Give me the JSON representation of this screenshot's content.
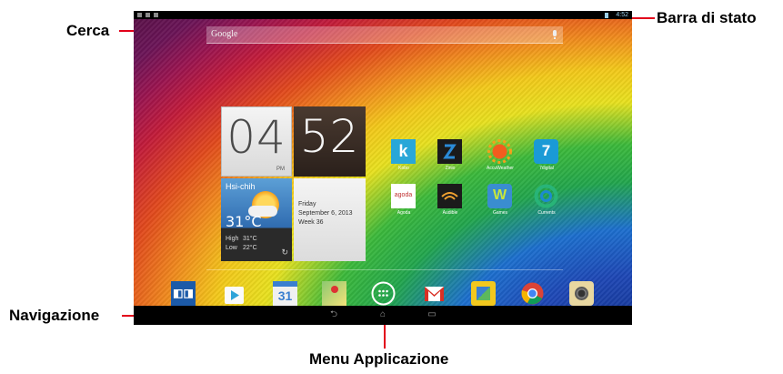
{
  "callouts": {
    "search": "Cerca",
    "status_bar": "Barra di stato",
    "navigation": "Navigazione",
    "app_menu": "Menu Applicazione"
  },
  "status_bar": {
    "time": "4:52"
  },
  "search": {
    "placeholder": "Google"
  },
  "clock": {
    "hour": "04",
    "minute": "52",
    "ampm": "PM"
  },
  "weather": {
    "city": "Hsi-chih",
    "temp": "31°C",
    "high_label": "High",
    "high_value": "31°C",
    "low_label": "Low",
    "low_value": "22°C"
  },
  "date_widget": {
    "day": "Friday",
    "date": "September 6, 2013",
    "week": "Week 36"
  },
  "apps": [
    {
      "label": "Kobo",
      "icon": "kobo-icon",
      "color": "#29a7d8"
    },
    {
      "label": "Zinio",
      "icon": "zinio-icon",
      "color": "#1a1a1a"
    },
    {
      "label": "AccuWeather",
      "icon": "accuweather-icon",
      "color": "#f47a20"
    },
    {
      "label": "7digital",
      "icon": "7digital-icon",
      "color": "#1a9ad6"
    },
    {
      "label": "Agoda",
      "icon": "agoda-icon",
      "color": "#ffffff"
    },
    {
      "label": "Audible",
      "icon": "audible-icon",
      "color": "#1b1b1b"
    },
    {
      "label": "Games",
      "icon": "games-icon",
      "color": "#3a8dd0"
    },
    {
      "label": "Currents",
      "icon": "currents-icon",
      "color": "#20a070"
    }
  ],
  "app_glyphs": {
    "kobo": "k",
    "agoda": "agoda",
    "calendar": "31"
  },
  "dock": [
    "dolby-icon",
    "play-store-icon",
    "calendar-icon",
    "maps-icon",
    "app-drawer-icon",
    "gmail-icon",
    "photo-icon",
    "chrome-icon",
    "camera-icon"
  ]
}
